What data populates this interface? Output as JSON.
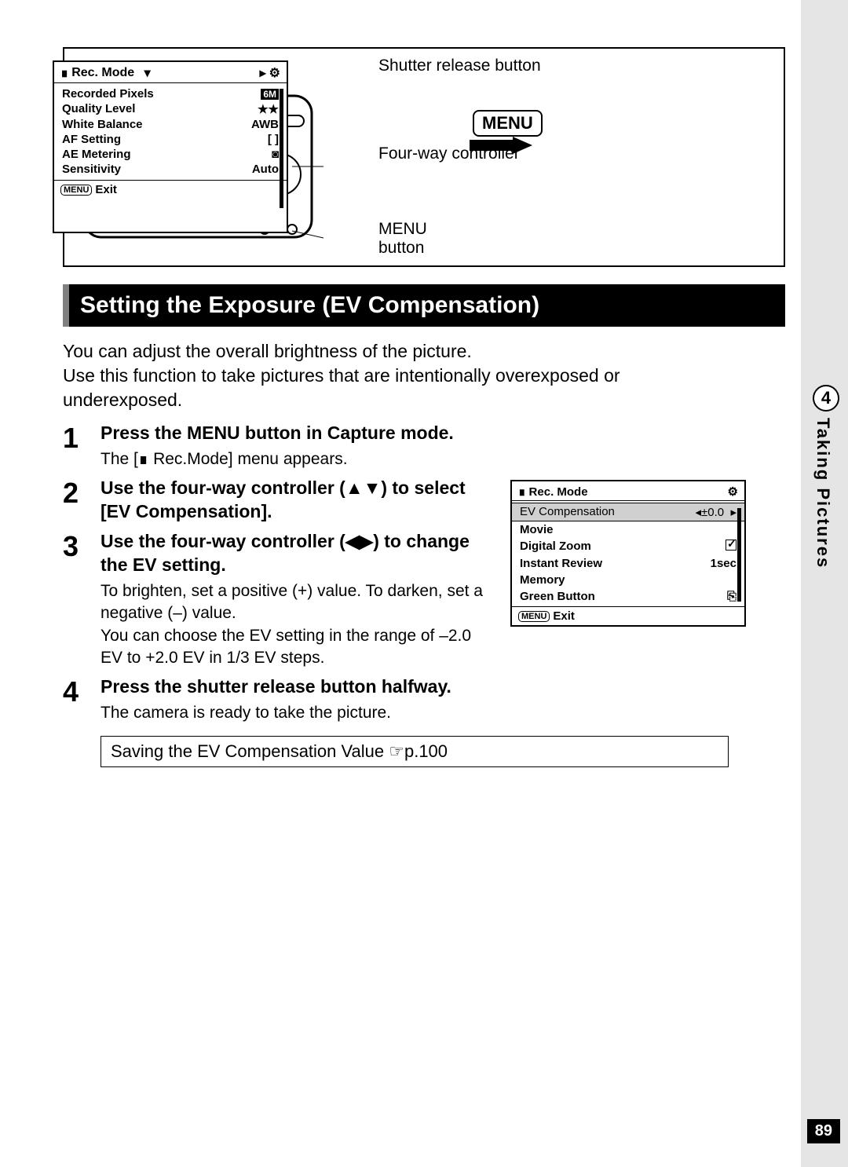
{
  "sidebar": {
    "chapter_number": "4",
    "chapter_title": "Taking Pictures"
  },
  "page_number": "89",
  "diagram": {
    "label_shutter": "Shutter release button",
    "label_fourway": "Four-way controller",
    "label_menu": "MENU button",
    "menu_badge": "MENU"
  },
  "lcd1": {
    "tab": "Rec. Mode",
    "rows": [
      {
        "k": "Recorded Pixels",
        "v": "6M"
      },
      {
        "k": "Quality Level",
        "v": "★★"
      },
      {
        "k": "White Balance",
        "v": "AWB"
      },
      {
        "k": "AF Setting",
        "v": "[ ]"
      },
      {
        "k": "AE Metering",
        "v": "◙"
      },
      {
        "k": "Sensitivity",
        "v": "Auto"
      }
    ],
    "menu": "MENU",
    "exit": "Exit"
  },
  "heading": "Setting the Exposure (EV Compensation)",
  "intro": "You can adjust the overall brightness of the picture.\nUse this function to take pictures that are intentionally overexposed or underexposed.",
  "steps": {
    "s1": {
      "title": "Press the MENU button in Capture mode.",
      "desc_prefix": "The [",
      "desc_suffix": " Rec.Mode] menu appears."
    },
    "s2": {
      "title": "Use the four-way controller (▲▼) to select [EV Compensation]."
    },
    "s3": {
      "title": "Use the four-way controller (◀▶) to change the EV setting.",
      "desc": "To brighten, set a positive (+) value. To darken, set a negative (–) value.\nYou can choose the EV setting in the range of –2.0 EV to +2.0 EV in 1/3 EV steps."
    },
    "s4": {
      "title": "Press the shutter release button halfway.",
      "desc": "The camera is ready to take the picture."
    }
  },
  "lcd2": {
    "tab": "Rec. Mode",
    "sel_k": "EV Compensation",
    "sel_v": "±0.0",
    "rows": [
      {
        "k": "Movie",
        "v": ""
      },
      {
        "k": "Digital Zoom",
        "v": "check"
      },
      {
        "k": "Instant Review",
        "v": "1sec"
      },
      {
        "k": "Memory",
        "v": ""
      },
      {
        "k": "Green Button",
        "v": "⎘"
      }
    ],
    "menu": "MENU",
    "exit": "Exit"
  },
  "reference": "Saving the EV Compensation Value ☞p.100"
}
